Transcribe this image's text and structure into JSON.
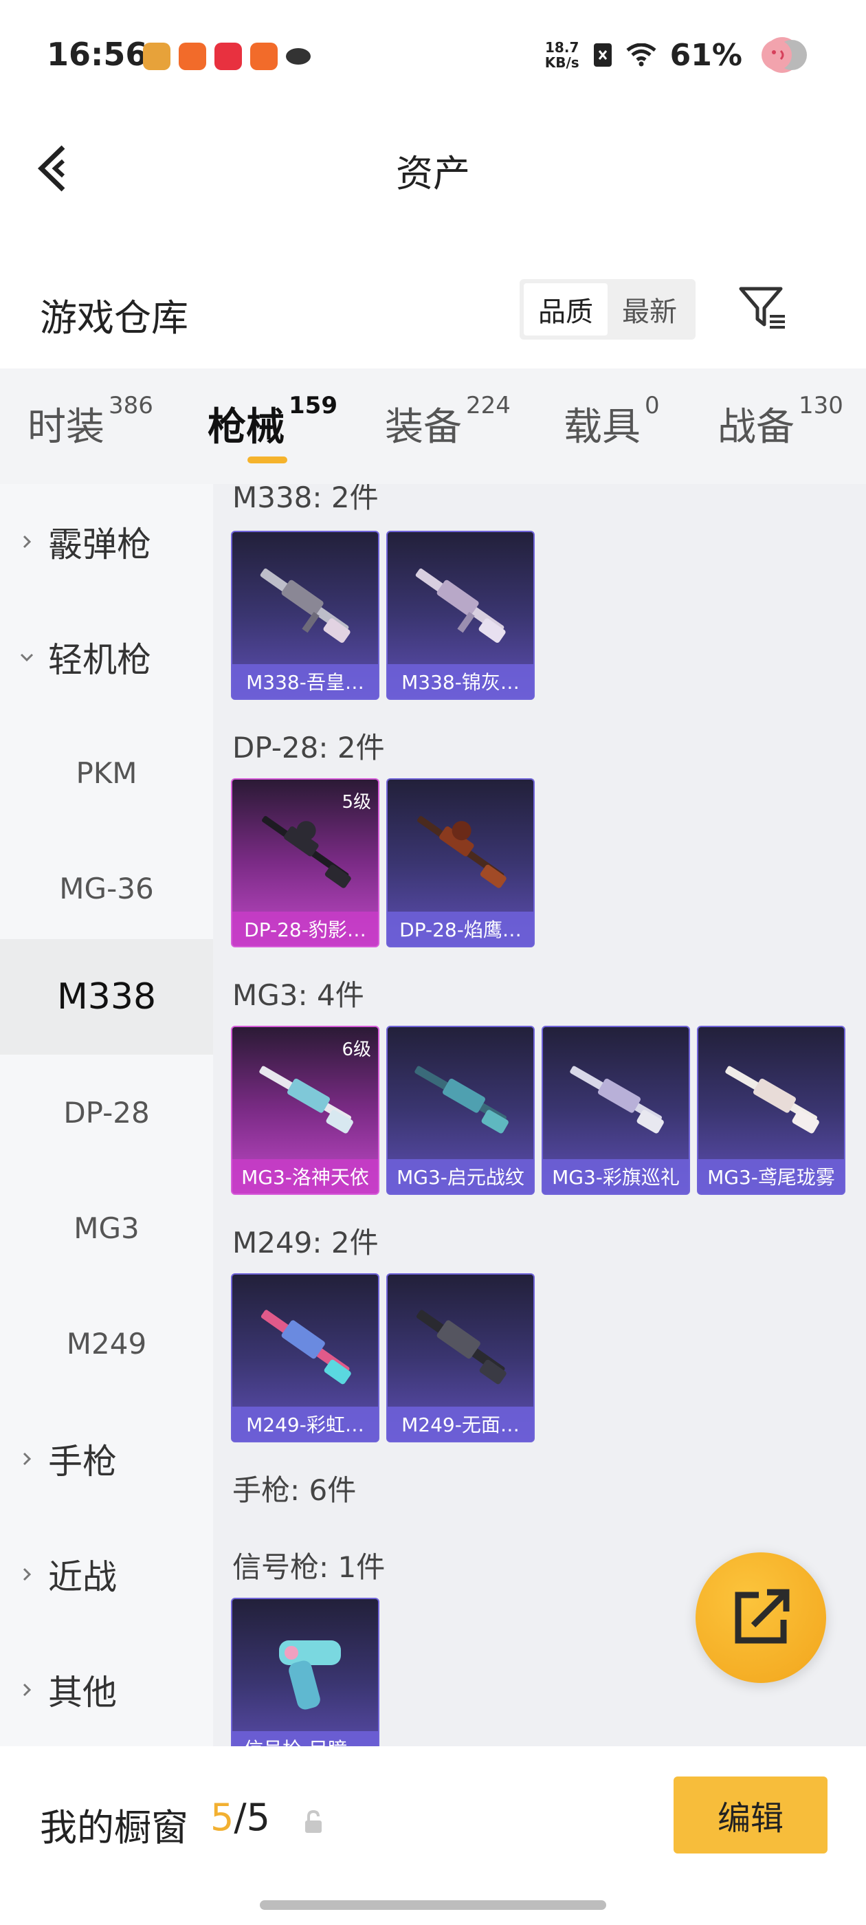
{
  "status_bar": {
    "time": "16:56",
    "net_speed_value": "18.7",
    "net_speed_unit": "KB/s",
    "battery": "61%"
  },
  "header": {
    "title": "资产"
  },
  "warehouse": {
    "title": "游戏仓库",
    "sort_options": [
      "品质",
      "最新"
    ],
    "sort_active": "品质"
  },
  "tabs": [
    {
      "label": "时装",
      "count": "386"
    },
    {
      "label": "枪械",
      "count": "159",
      "active": true
    },
    {
      "label": "装备",
      "count": "224"
    },
    {
      "label": "载具",
      "count": "0"
    },
    {
      "label": "战备",
      "count": "130"
    }
  ],
  "sidebar": [
    {
      "label": "霰弹枪",
      "type": "group",
      "expanded": false
    },
    {
      "label": "轻机枪",
      "type": "group",
      "expanded": true
    },
    {
      "label": "PKM",
      "type": "sub"
    },
    {
      "label": "MG-36",
      "type": "sub"
    },
    {
      "label": "M338",
      "type": "sub",
      "selected": true
    },
    {
      "label": "DP-28",
      "type": "sub"
    },
    {
      "label": "MG3",
      "type": "sub"
    },
    {
      "label": "M249",
      "type": "sub"
    },
    {
      "label": "手枪",
      "type": "group",
      "expanded": false
    },
    {
      "label": "近战",
      "type": "group",
      "expanded": false
    },
    {
      "label": "其他",
      "type": "group",
      "expanded": false
    }
  ],
  "groups": [
    {
      "label": "M338: 2件",
      "items": [
        {
          "name": "M338-吾皇…",
          "rarity": "purple"
        },
        {
          "name": "M338-锦灰…",
          "rarity": "purple"
        }
      ]
    },
    {
      "label": "DP-28: 2件",
      "items": [
        {
          "name": "DP-28-豹影…",
          "rarity": "pink",
          "level": "5级"
        },
        {
          "name": "DP-28-焰鹰…",
          "rarity": "purple"
        }
      ]
    },
    {
      "label": "MG3: 4件",
      "items": [
        {
          "name": "MG3-洛神天依",
          "rarity": "pink",
          "level": "6级"
        },
        {
          "name": "MG3-启元战纹",
          "rarity": "purple"
        },
        {
          "name": "MG3-彩旗巡礼",
          "rarity": "purple"
        },
        {
          "name": "MG3-鸢尾珑雾",
          "rarity": "purple"
        }
      ]
    },
    {
      "label": "M249: 2件",
      "items": [
        {
          "name": "M249-彩虹…",
          "rarity": "purple"
        },
        {
          "name": "M249-无面…",
          "rarity": "purple"
        }
      ]
    },
    {
      "label": "手枪: 6件",
      "items": []
    },
    {
      "label": "信号枪: 1件",
      "items": [
        {
          "name": "信号枪-目瞳…",
          "rarity": "purple"
        }
      ]
    }
  ],
  "bottom": {
    "showcase_label": "我的橱窗",
    "showcase_current": "5",
    "showcase_sep": "/",
    "showcase_total": "5",
    "edit_label": "编辑"
  },
  "colors": {
    "accent": "#f2b031",
    "purple_card": "#5e4fb3",
    "pink_card": "#c14ac8"
  }
}
